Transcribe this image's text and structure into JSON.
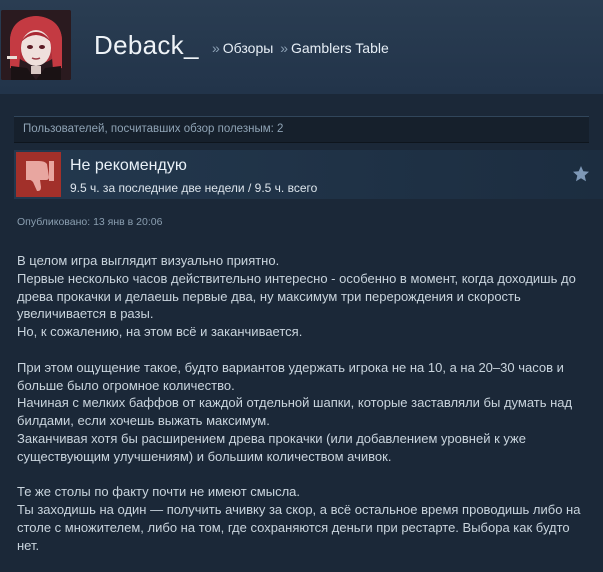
{
  "header": {
    "username": "Deback_",
    "breadcrumb_separator": "»",
    "breadcrumb": [
      "Обзоры",
      "Gamblers Table"
    ]
  },
  "helpful": {
    "text": "Пользователей, посчитавших обзор полезным: 2"
  },
  "verdict": {
    "title": "Не рекомендую",
    "hours": "9.5 ч. за последние две недели / 9.5 ч. всего",
    "thumb_icon": "thumbs-down-icon",
    "award_icon": "award-star-icon",
    "thumb_bg_color": "#a2302a"
  },
  "posted": "Опубликовано: 13 янв в 20:06",
  "review": {
    "paragraphs": [
      "В целом игра выглядит визуально приятно.\nПервые несколько часов действительно интересно - особенно в момент, когда доходишь до древа прокачки и делаешь первые два, ну максимум три перерождения и скорость увеличивается в разы.\nНо, к сожалению, на этом всё и заканчивается.",
      "При этом ощущение такое, будто вариантов удержать игрока не на 10, а на 20–30 часов и больше было огромное количество.\nНачиная с мелких баффов от каждой отдельной шапки, которые заставляли бы думать над билдами, если хочешь выжать максимум.\nЗаканчивая хотя бы расширением древа прокачки (или добавлением уровней к уже существующим улучшениям) и большим количеством ачивок.",
      "Те же столы по факту почти не имеют смысла.\nТы заходишь на один — получить ачивку за скор, а всё остальное время проводишь либо на столе с множителем, либо на том, где сохраняются деньги при рестарте. Выбора как будто нет."
    ]
  }
}
